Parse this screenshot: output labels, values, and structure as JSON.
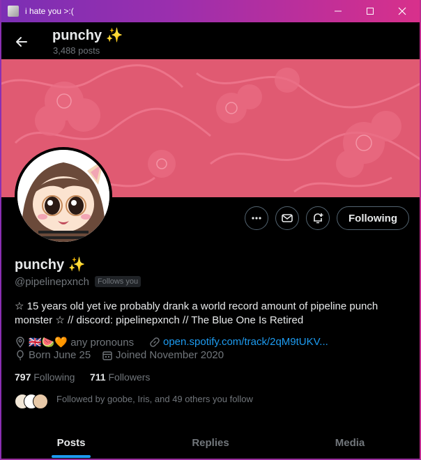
{
  "window": {
    "title": "i hate you >:("
  },
  "header": {
    "name": "punchy ✨",
    "post_count": "3,488 posts"
  },
  "profile": {
    "display_name": "punchy ✨",
    "handle": "@pipelinepxnch",
    "follows_you_badge": "Follows you",
    "bio": "☆ 15 years old yet ive probably drank a world record amount of pipeline punch monster ☆ // discord: pipelinepxnch // The Blue One Is Retired",
    "location": "🇬🇧🍉🧡 any pronouns",
    "link": "open.spotify.com/track/2qM9tUKV...",
    "birthday": "Born June 25",
    "joined": "Joined November 2020",
    "following_count": "797",
    "following_label": "Following",
    "followers_count": "711",
    "followers_label": "Followers",
    "followed_by": "Followed by goobe, Iris, and 49 others you follow"
  },
  "actions": {
    "follow_button": "Following"
  },
  "tabs": [
    {
      "label": "Posts",
      "active": true
    },
    {
      "label": "Replies",
      "active": false
    },
    {
      "label": "Media",
      "active": false
    }
  ],
  "colors": {
    "accent": "#1d9bf0",
    "banner": "#e05a72",
    "muted_text": "#71767b",
    "titlebar_left": "#7b2fb4",
    "titlebar_right": "#d8308b"
  }
}
